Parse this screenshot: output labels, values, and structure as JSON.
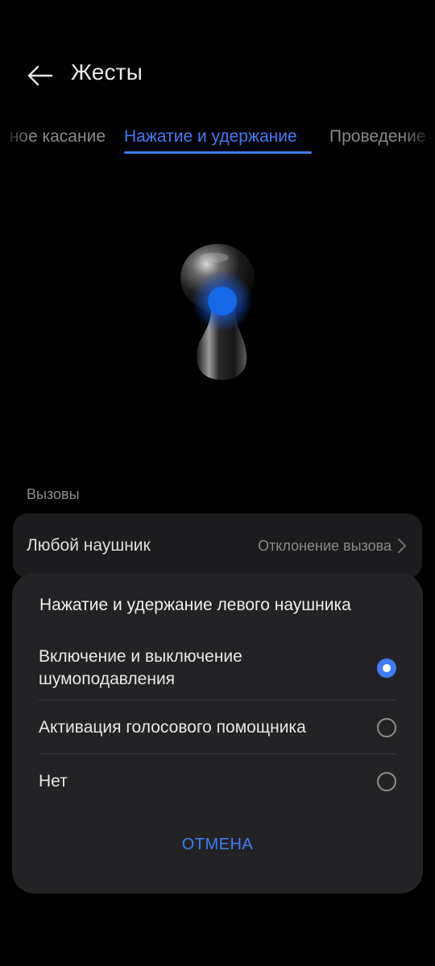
{
  "header": {
    "title": "Жесты",
    "back_icon": "arrow-left-icon"
  },
  "tabs": [
    {
      "label": "ное касание",
      "active": false
    },
    {
      "label": "Нажатие и удержание",
      "active": true
    },
    {
      "label": "Проведение",
      "active": false
    }
  ],
  "colors": {
    "accent": "#3f7df6",
    "background": "#000000",
    "card": "#1c1c1e",
    "sheet": "#232325"
  },
  "illustration": {
    "icon": "earbud-illustration",
    "highlight": "touch-point-icon"
  },
  "section": {
    "label": "Вызовы"
  },
  "setting": {
    "label": "Любой наушник",
    "value": "Отклонение вызова",
    "icon": "chevron-right-icon"
  },
  "dialog": {
    "title": "Нажатие и удержание левого наушника",
    "options": [
      {
        "label": "Включение и выключение шумоподавления",
        "selected": true
      },
      {
        "label": "Активация голосового помощника",
        "selected": false
      },
      {
        "label": "Нет",
        "selected": false
      }
    ],
    "cancel_label": "ОТМЕНА"
  }
}
